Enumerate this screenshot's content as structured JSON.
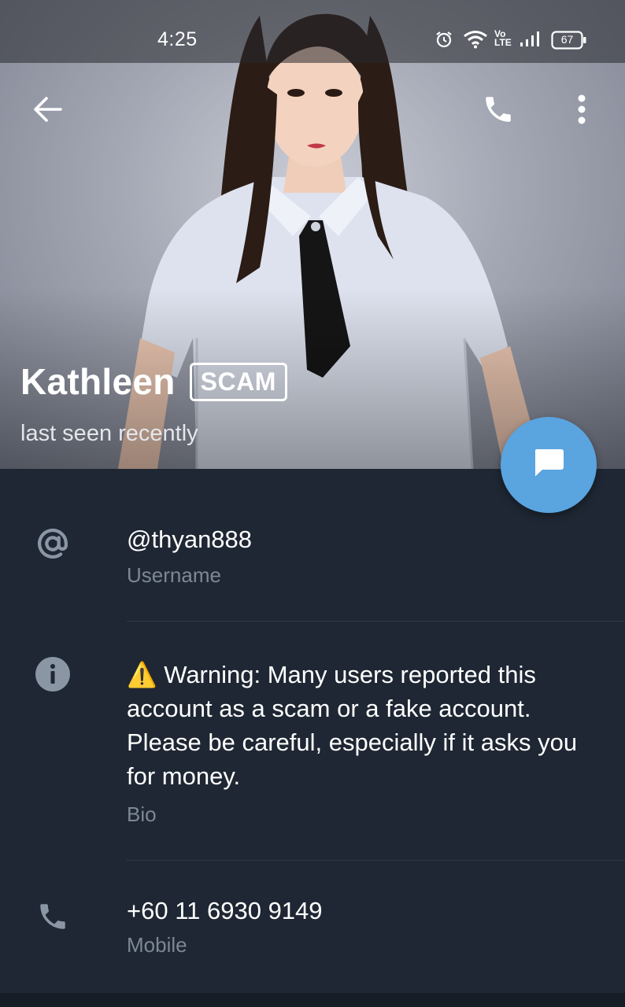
{
  "status_bar": {
    "time": "4:25",
    "battery": "67",
    "icons": [
      "alarm-icon",
      "wifi-icon",
      "volte-icon",
      "signal-icon",
      "battery-icon"
    ]
  },
  "app_bar": {
    "back_icon": "arrow-left-icon",
    "call_icon": "phone-icon",
    "menu_icon": "more-vertical-icon"
  },
  "profile": {
    "name": "Kathleen",
    "badge": "SCAM",
    "status": "last seen recently"
  },
  "fab": {
    "icon": "message-icon"
  },
  "info": {
    "username": {
      "value": "@thyan888",
      "label": "Username",
      "icon": "at-icon"
    },
    "bio": {
      "value": "⚠️ Warning: Many users reported this account as a scam or a fake account. Please be careful, especially if it asks you for money.",
      "label": "Bio",
      "icon": "info-icon"
    },
    "phone": {
      "value": "+60 11 6930 9149",
      "label": "Mobile",
      "icon": "phone-icon"
    }
  },
  "colors": {
    "background": "#1e2733",
    "accent": "#5aa4e0",
    "secondary_text": "#7d8895"
  }
}
